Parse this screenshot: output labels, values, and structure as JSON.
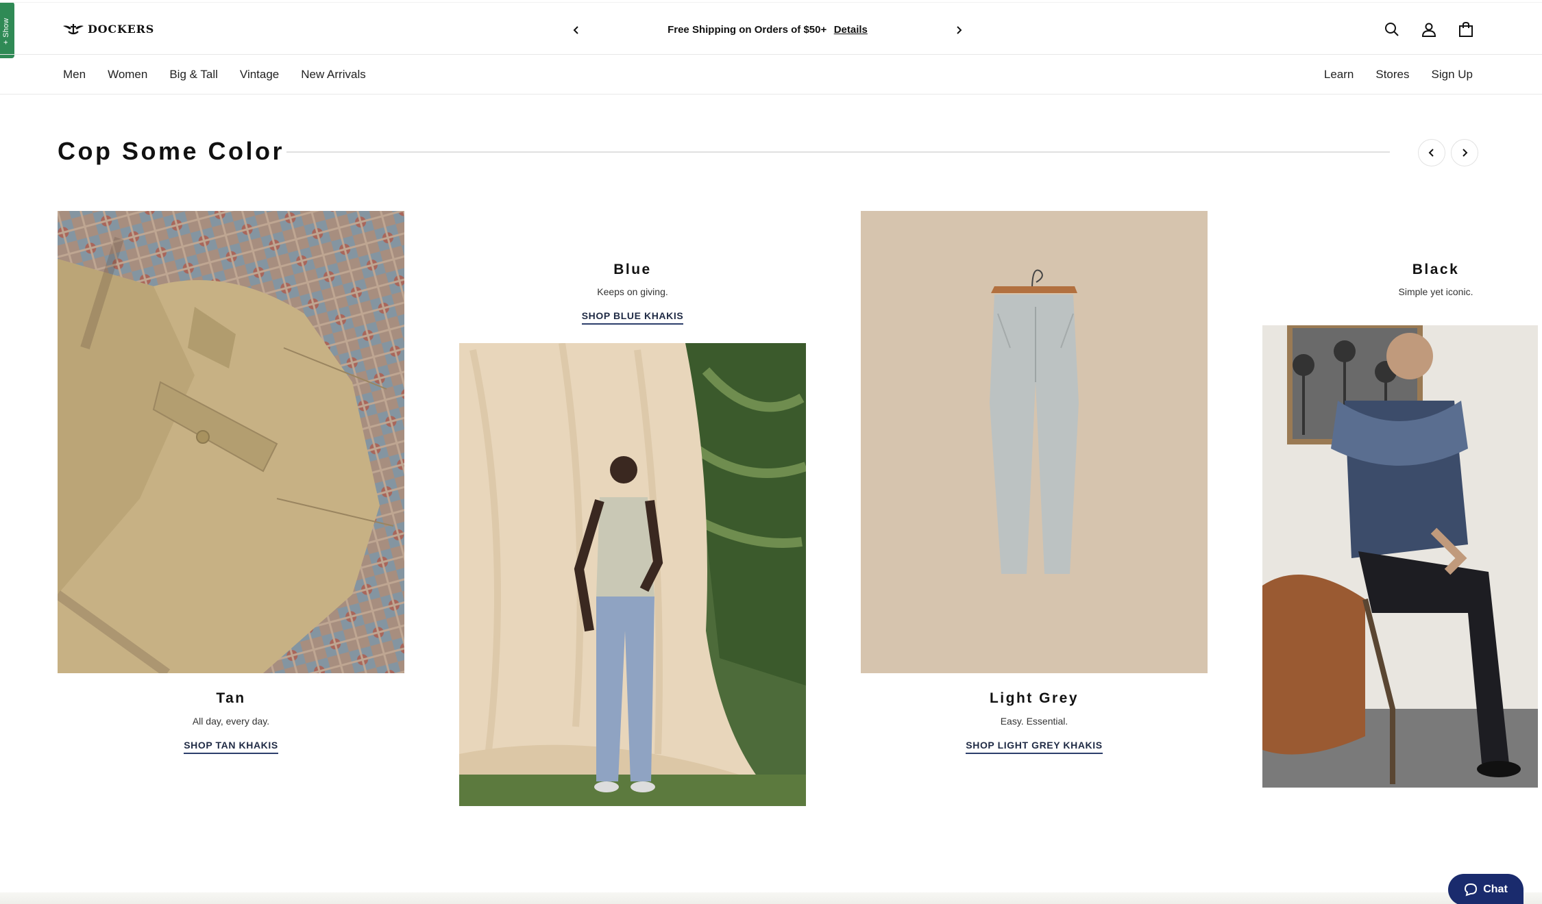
{
  "side_tab": {
    "label": "+ Show"
  },
  "brand": {
    "logo_text": "DOCKERS"
  },
  "promo": {
    "text": "Free Shipping on Orders of $50+",
    "link": "Details"
  },
  "nav": {
    "left": [
      "Men",
      "Women",
      "Big & Tall",
      "Vintage",
      "New Arrivals"
    ],
    "right": [
      "Learn",
      "Stores",
      "Sign Up"
    ]
  },
  "header_icons": [
    "search-icon",
    "account-icon",
    "bag-icon"
  ],
  "section": {
    "title": "Cop Some Color"
  },
  "cards": [
    {
      "title": "Tan",
      "subtitle": "All day, every day.",
      "link": "SHOP TAN KHAKIS"
    },
    {
      "title": "Blue",
      "subtitle": "Keeps on giving.",
      "link": "SHOP BLUE KHAKIS"
    },
    {
      "title": "Light Grey",
      "subtitle": "Easy. Essential.",
      "link": "SHOP LIGHT GREY KHAKIS"
    },
    {
      "title": "Black",
      "subtitle": "Simple yet iconic.",
      "link": ""
    }
  ],
  "chat": {
    "label": "Chat"
  },
  "colors": {
    "side_tab": "#2f8a55",
    "link_underline": "#2c3e6b",
    "chat_button": "#1a2b6d"
  }
}
